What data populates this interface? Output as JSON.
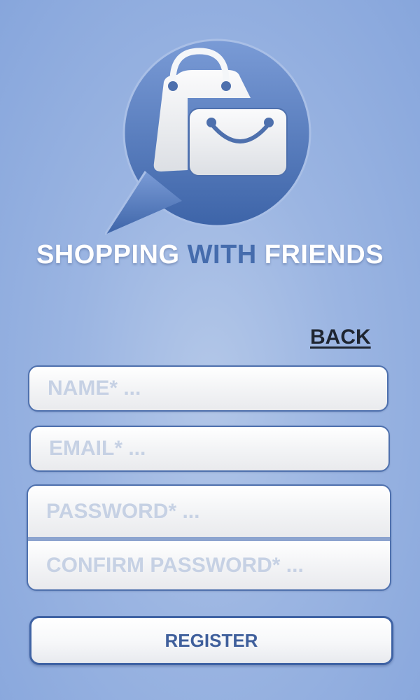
{
  "header": {
    "logo_icon": "shopping-bags-speech-bubble-icon",
    "title_part1": "SHOPPING",
    "title_part2": "WITH",
    "title_part3": "FRIENDS"
  },
  "nav": {
    "back_label": "BACK"
  },
  "form": {
    "name_placeholder": "NAME* ...",
    "email_placeholder": "EMAIL* ...",
    "password_placeholder": "PASSWORD* ...",
    "confirm_password_placeholder": "CONFIRM PASSWORD* ...",
    "register_label": "REGISTER"
  },
  "colors": {
    "background": "#9bb5e2",
    "accent": "#456cad",
    "field_border": "#4e70ad",
    "placeholder": "#c6d1e4",
    "back_link": "#1e2530"
  }
}
